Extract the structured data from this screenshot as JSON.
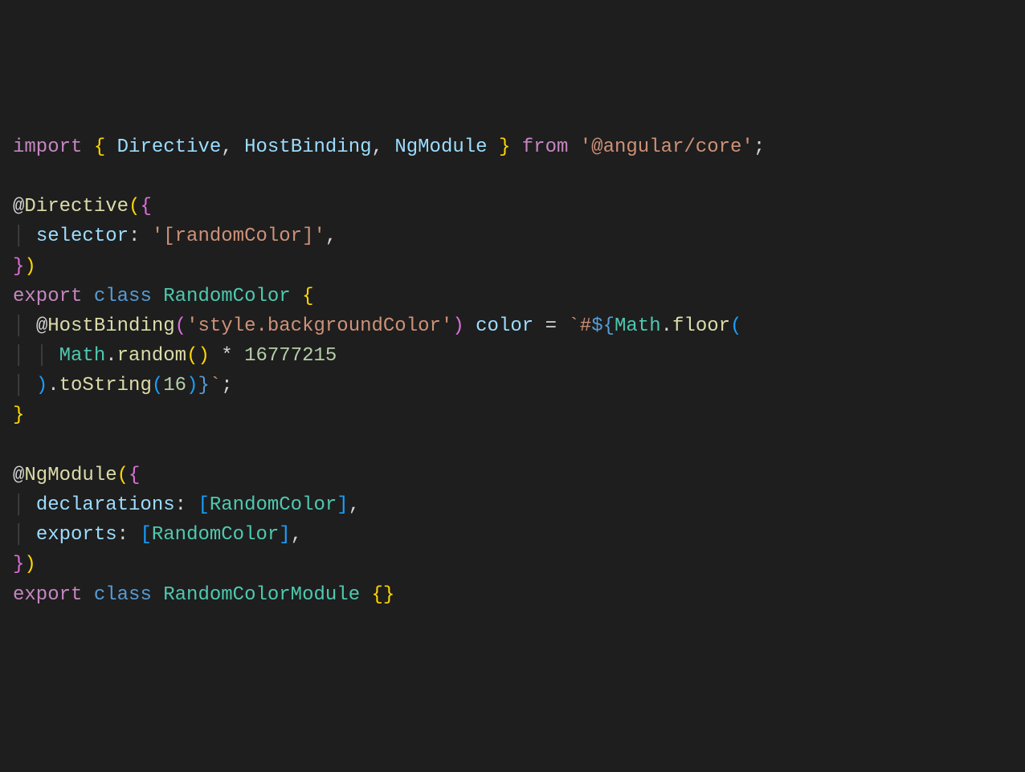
{
  "code": {
    "t_import": "import",
    "t_Directive": "Directive",
    "t_HostBinding": "HostBinding",
    "t_NgModule": "NgModule",
    "t_from": "from",
    "s_angular_core": "'@angular/core'",
    "t_at": "@",
    "t_selector": "selector",
    "s_randomColor": "'[randomColor]'",
    "t_export": "export",
    "t_class": "class",
    "t_RandomColor": "RandomColor",
    "s_styleBg": "'style.backgroundColor'",
    "t_color": "color",
    "s_backtick1": "`",
    "s_hash": "#",
    "s_dollar_open": "${",
    "t_Math": "Math",
    "t_floor": "floor",
    "t_random": "random",
    "t_mul": "*",
    "n_max": "16777215",
    "t_toString": "toString",
    "n_radix": "16",
    "s_close_tmpl": "}",
    "s_backtick2": "`",
    "t_declarations": "declarations",
    "t_exports": "exports",
    "t_RandomColorModule": "RandomColorModule",
    "lbrace": "{",
    "rbrace": "}",
    "lparen": "(",
    "rparen": ")",
    "lbracket": "[",
    "rbracket": "]",
    "comma": ",",
    "semi": ";",
    "colon": ":",
    "dot": ".",
    "eq": "=",
    "sp": " ",
    "indent1": "  ",
    "indent2": "    ",
    "pipe": "│"
  }
}
